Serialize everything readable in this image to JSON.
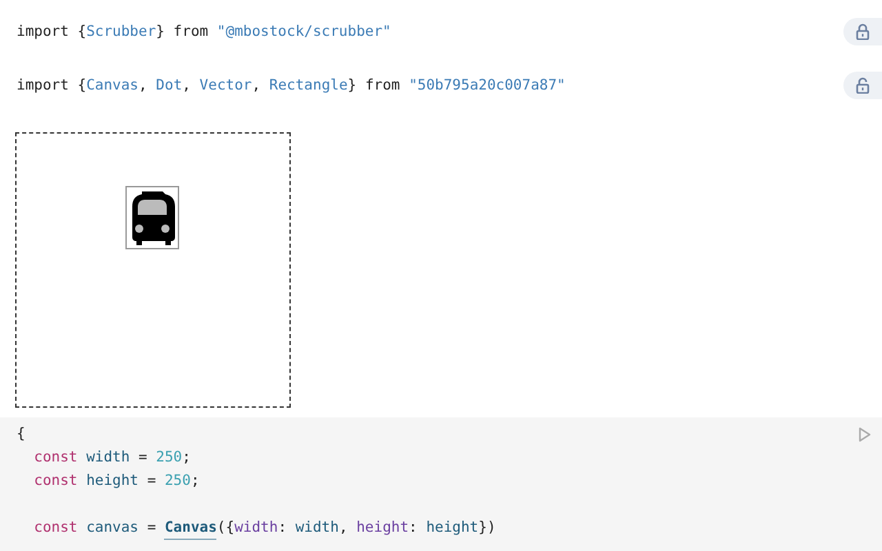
{
  "cells": [
    {
      "kind": "import",
      "locked": true,
      "lines": [
        {
          "indented": false,
          "tokens": [
            {
              "t": "import {",
              "kind": "p"
            },
            {
              "t": "Scrubber",
              "kind": "name"
            },
            {
              "t": "} from ",
              "kind": "p"
            },
            {
              "t": "\"@mbostock/scrubber\"",
              "kind": "str"
            }
          ]
        }
      ]
    },
    {
      "kind": "import",
      "locked": false,
      "lines": [
        {
          "indented": false,
          "tokens": [
            {
              "t": "import {",
              "kind": "p"
            },
            {
              "t": "Canvas",
              "kind": "name"
            },
            {
              "t": ", ",
              "kind": "p"
            },
            {
              "t": "Dot",
              "kind": "name"
            },
            {
              "t": ", ",
              "kind": "p"
            },
            {
              "t": "Vector",
              "kind": "name"
            },
            {
              "t": ", ",
              "kind": "p"
            },
            {
              "t": "Rectangle",
              "kind": "name"
            },
            {
              "t": "} from ",
              "kind": "p"
            },
            {
              "t": "\"50b795a20c007a87\"",
              "kind": "str"
            }
          ]
        }
      ]
    },
    {
      "kind": "canvas"
    },
    {
      "kind": "code",
      "lines": [
        {
          "indented": false,
          "tokens": [
            {
              "t": "{",
              "kind": "p"
            }
          ]
        },
        {
          "indented": true,
          "tokens": [
            {
              "t": "const ",
              "kind": "kw"
            },
            {
              "t": "width",
              "kind": "var"
            },
            {
              "t": " = ",
              "kind": "p"
            },
            {
              "t": "250",
              "kind": "num"
            },
            {
              "t": ";",
              "kind": "p"
            }
          ]
        },
        {
          "indented": true,
          "tokens": [
            {
              "t": "const ",
              "kind": "kw"
            },
            {
              "t": "height",
              "kind": "var"
            },
            {
              "t": " = ",
              "kind": "p"
            },
            {
              "t": "250",
              "kind": "num"
            },
            {
              "t": ";",
              "kind": "p"
            }
          ]
        },
        {
          "indented": true,
          "gap_before": true,
          "tokens": [
            {
              "t": "const ",
              "kind": "kw"
            },
            {
              "t": "canvas",
              "kind": "var"
            },
            {
              "t": " = ",
              "kind": "p"
            },
            {
              "t": "Canvas",
              "kind": "call"
            },
            {
              "t": "({",
              "kind": "p"
            },
            {
              "t": "width",
              "kind": "prop"
            },
            {
              "t": ": ",
              "kind": "p"
            },
            {
              "t": "width",
              "kind": "var"
            },
            {
              "t": ", ",
              "kind": "p"
            },
            {
              "t": "height",
              "kind": "prop"
            },
            {
              "t": ": ",
              "kind": "p"
            },
            {
              "t": "height",
              "kind": "var"
            },
            {
              "t": "})",
              "kind": "p"
            }
          ]
        }
      ]
    }
  ]
}
